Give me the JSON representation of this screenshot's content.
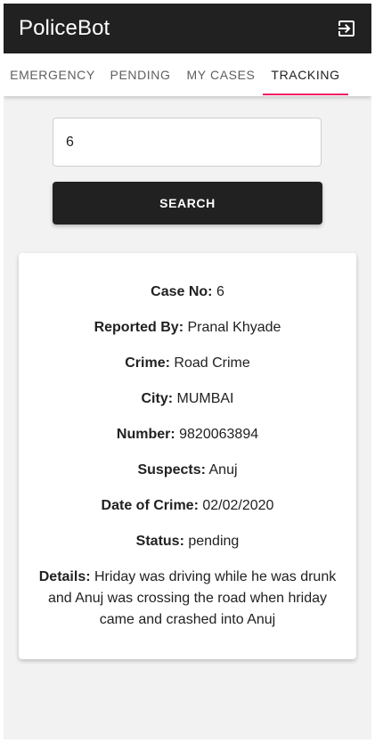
{
  "app": {
    "title": "PoliceBot",
    "logout_icon": "logout-icon"
  },
  "tabs": [
    {
      "label": "EMERGENCY",
      "active": false
    },
    {
      "label": "PENDING",
      "active": false
    },
    {
      "label": "MY CASES",
      "active": false
    },
    {
      "label": "TRACKING",
      "active": true
    }
  ],
  "search": {
    "value": "6",
    "button_label": "SEARCH"
  },
  "case": {
    "case_no_label": "Case No:",
    "case_no": "6",
    "reported_by_label": "Reported By:",
    "reported_by": "Pranal Khyade",
    "crime_label": "Crime:",
    "crime": "Road Crime",
    "city_label": "City:",
    "city": "MUMBAI",
    "number_label": "Number:",
    "number": "9820063894",
    "suspects_label": "Suspects:",
    "suspects": "Anuj",
    "date_label": "Date of Crime:",
    "date": "02/02/2020",
    "status_label": "Status:",
    "status": "pending",
    "details_label": "Details:",
    "details": "Hriday was driving while he was drunk and Anuj was crossing the road when hriday came and crashed into Anuj"
  },
  "colors": {
    "appbar": "#212121",
    "accent": "#e91e63",
    "background": "#f2f2f2"
  }
}
